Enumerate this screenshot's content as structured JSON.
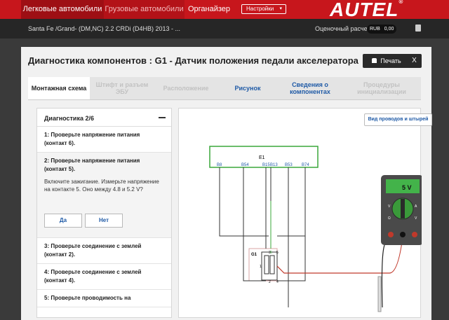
{
  "topnav": {
    "tabs": [
      {
        "label": "Легковые автомобили"
      },
      {
        "label": "Грузовые автомобили"
      },
      {
        "label": "Органайзер"
      }
    ],
    "settings_label": "Настройки",
    "logo": "AUTEL"
  },
  "subbar": {
    "vehicle": "Santa Fe /Grand- (DM,NC) 2.2 CRDi (D4HB) 2013 - ...",
    "estimate_label": "Оценочный расчет",
    "currency": "RUB",
    "amount": "0,00"
  },
  "dialog": {
    "title": "Диагностика компонентов : G1 - Датчик положения педали акселератора",
    "print_label": "Печать",
    "close_label": "X",
    "tabs": [
      {
        "line1": "Монтажная схема",
        "line2": ""
      },
      {
        "line1": "Штифт и разъем",
        "line2": "ЭБУ"
      },
      {
        "line1": "Расположение",
        "line2": ""
      },
      {
        "line1": "Рисунок",
        "line2": ""
      },
      {
        "line1": "Сведения о",
        "line2": "компонентах"
      },
      {
        "line1": "Процедуры",
        "line2": "инициализации"
      }
    ]
  },
  "diagnostics": {
    "header": "Диагностика 2/6",
    "steps": [
      {
        "title": "1: Проверьте напряжение питания (контакт 6)."
      },
      {
        "title": "2: Проверьте напряжение питания (контакт 5).",
        "description": "Включите зажигание. Измерьте напряжение на контакте 5. Оно между 4.8 и 5.2 V?"
      },
      {
        "title": "3: Проверьте соединение с землей (контакт 2)."
      },
      {
        "title": "4: Проверьте соединение с землей (контакт 4)."
      },
      {
        "title": "5: Проверьте проводимость на"
      }
    ],
    "yes_label": "Да",
    "no_label": "Нет"
  },
  "diagram": {
    "wire_view_label": "Вид проводов и штырей",
    "ecu_label": "E1",
    "ecu_pins": [
      "B8",
      "B54",
      "B15",
      "B13",
      "B53",
      "B74"
    ],
    "sensor_label": "G1",
    "sensor_pins": [
      "1",
      "2",
      "3",
      "4",
      "5",
      "6"
    ],
    "meter_reading": "5 V",
    "meter_buttons": [
      "V",
      "A",
      "Ω",
      "V"
    ],
    "colors": {
      "ecu_border": "#3aa73a",
      "meter_body": "#4a4a4a",
      "meter_screen": "#43b34a",
      "probe_black": "#222222",
      "probe_red": "#c0392b"
    }
  }
}
